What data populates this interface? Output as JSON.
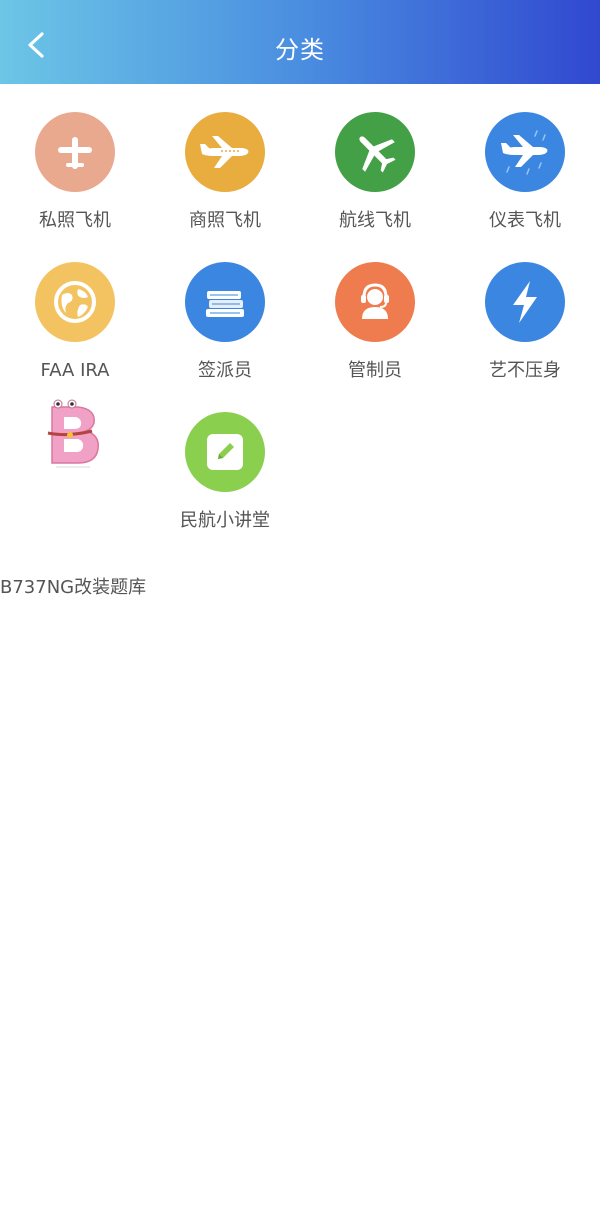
{
  "header": {
    "title": "分类"
  },
  "categories": [
    {
      "label": "私照飞机",
      "icon": "plane-icon",
      "color": "#e9a98f"
    },
    {
      "label": "商照飞机",
      "icon": "airliner-icon",
      "color": "#e8ad3e"
    },
    {
      "label": "航线飞机",
      "icon": "jet-icon",
      "color": "#43a046"
    },
    {
      "label": "仪表飞机",
      "icon": "rain-plane-icon",
      "color": "#3a86e0"
    },
    {
      "label": "FAA IRA",
      "icon": "globe-icon",
      "color": "#f4c361"
    },
    {
      "label": "签派员",
      "icon": "books-icon",
      "color": "#3a86e0"
    },
    {
      "label": "管制员",
      "icon": "headset-icon",
      "color": "#ee7c4e"
    },
    {
      "label": "艺不压身",
      "icon": "lightning-icon",
      "color": "#3a86e0"
    },
    {
      "label": "B737NG改装题库",
      "icon": "letter-b-mascot-icon",
      "color": "#f1a0c6"
    },
    {
      "label": "民航小讲堂",
      "icon": "pencil-icon",
      "color": "#8bcf4f"
    }
  ]
}
